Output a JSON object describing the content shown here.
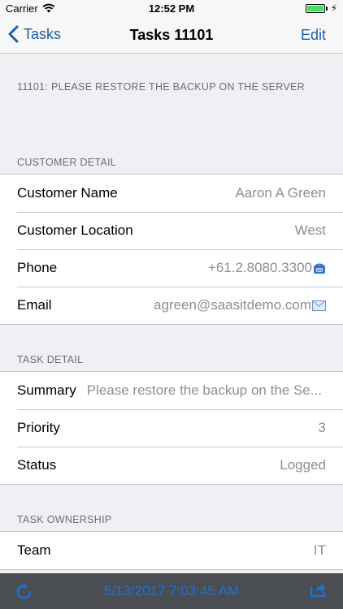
{
  "status_bar": {
    "carrier": "Carrier",
    "time": "12:52 PM"
  },
  "nav": {
    "back_label": "Tasks",
    "title": "Tasks 11101",
    "edit_label": "Edit"
  },
  "task": {
    "header": "11101: PLEASE RESTORE THE BACKUP ON THE SERVER"
  },
  "customer_detail": {
    "header": "CUSTOMER DETAIL",
    "name_label": "Customer Name",
    "name_value": "Aaron A Green",
    "location_label": "Customer Location",
    "location_value": "West",
    "phone_label": "Phone",
    "phone_value": "+61.2.8080.3300",
    "email_label": "Email",
    "email_value": "agreen@saasitdemo.com"
  },
  "task_detail": {
    "header": "TASK DETAIL",
    "summary_label": "Summary",
    "summary_value": "Please restore the backup on the Se...",
    "priority_label": "Priority",
    "priority_value": "3",
    "status_label": "Status",
    "status_value": "Logged"
  },
  "task_ownership": {
    "header": "TASK OWNERSHIP",
    "team_label": "Team",
    "team_value": "IT"
  },
  "toolbar": {
    "timestamp": "5/13/2017 7:03:45 AM"
  },
  "colors": {
    "accent": "#1e5fa8",
    "toolbar_bg": "#4a4d52",
    "timestamp": "#1f6fd8",
    "battery": "#4cd964"
  },
  "icons": {
    "wifi": "wifi-icon",
    "battery": "battery-icon",
    "back": "chevron-left-icon",
    "phone": "phone-icon",
    "email": "envelope-icon",
    "refresh": "refresh-icon",
    "share": "share-icon"
  }
}
